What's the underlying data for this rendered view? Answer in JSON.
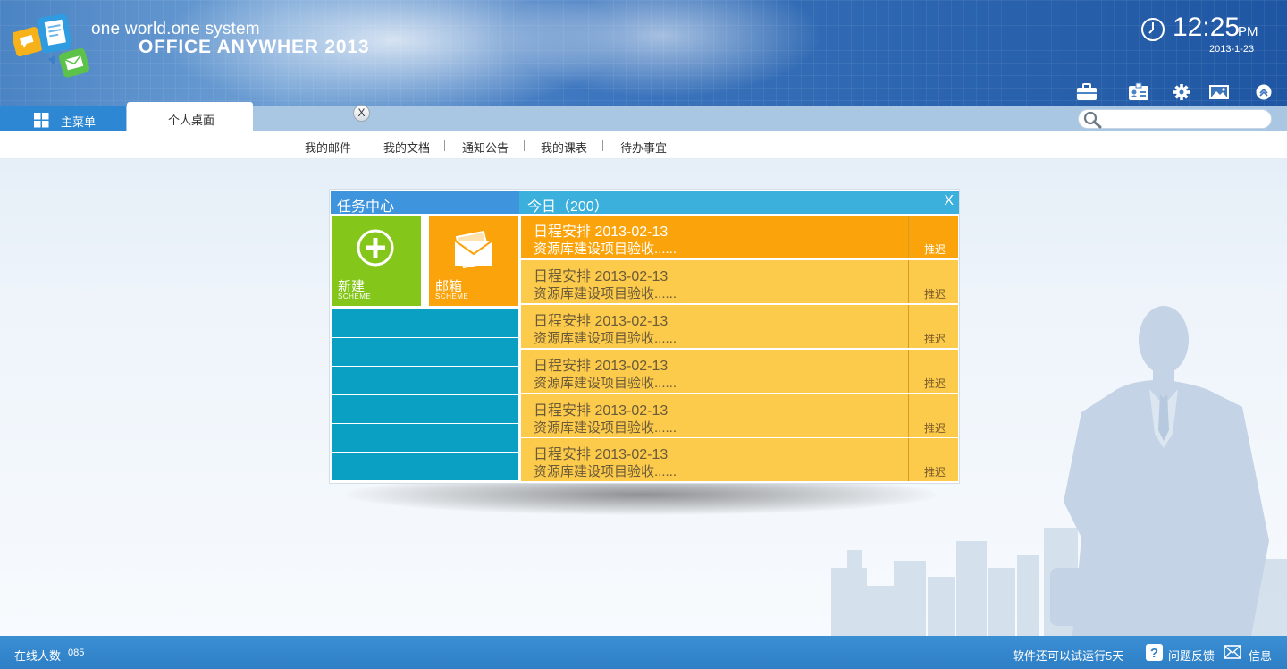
{
  "header": {
    "slogan": "one world.one system",
    "product": "OFFICE ANYWHER 2013",
    "time": "12:25",
    "ampm": "PM",
    "date": "2013-1-23",
    "tools": [
      "toolbox-icon",
      "id-card-icon",
      "gear-icon",
      "picture-icon",
      "collapse-up-icon"
    ]
  },
  "tabs": {
    "main_label": "主菜单",
    "desk_label": "个人桌面",
    "close_label": "X"
  },
  "search": {
    "value": "",
    "placeholder": ""
  },
  "subnav": [
    "我的邮件",
    "我的文档",
    "通知公告",
    "我的课表",
    "待办事宜"
  ],
  "task_center": {
    "title": "任务中心",
    "tiles": [
      {
        "name": "新建",
        "sub": "SCHEME",
        "color": "#84c61a"
      },
      {
        "name": "邮箱",
        "sub": "SCHEME",
        "color": "#fba30a"
      }
    ]
  },
  "today": {
    "title": "今日（200）",
    "close": "X",
    "items": [
      {
        "title": "日程安排 2013-02-13",
        "desc": "资源库建设项目验收......",
        "action": "推迟"
      },
      {
        "title": "日程安排 2013-02-13",
        "desc": "资源库建设项目验收......",
        "action": "推迟"
      },
      {
        "title": "日程安排 2013-02-13",
        "desc": "资源库建设项目验收......",
        "action": "推迟"
      },
      {
        "title": "日程安排 2013-02-13",
        "desc": "资源库建设项目验收......",
        "action": "推迟"
      },
      {
        "title": "日程安排 2013-02-13",
        "desc": "资源库建设项目验收......",
        "action": "推迟"
      },
      {
        "title": "日程安排 2013-02-13",
        "desc": "资源库建设项目验收......",
        "action": "推迟"
      }
    ]
  },
  "footer": {
    "online_label": "在线人数",
    "online_count": "085",
    "trial": "软件还可以试运行5天",
    "feedback": "问题反馈",
    "message": "信息"
  },
  "colors": {
    "header_blue": "#2d66b0",
    "tab_blue": "#2e87d2",
    "tile_green": "#84c61a",
    "tile_orange": "#fba30a",
    "task_yellow": "#fccb4b",
    "row_teal": "#0aa0c4"
  }
}
